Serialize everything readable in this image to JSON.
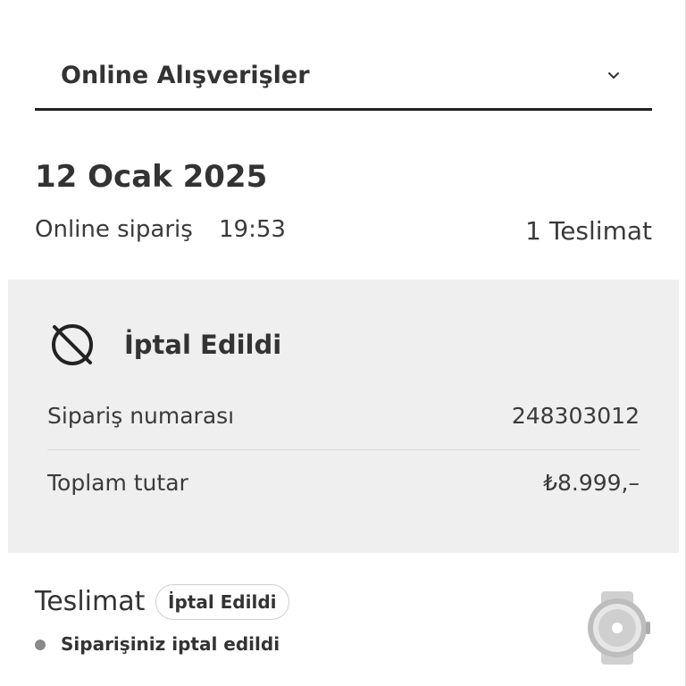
{
  "dropdown": {
    "title": "Online Alışverişler",
    "icon": "chevron-down-icon"
  },
  "order": {
    "date": "12 Ocak 2025",
    "type": "Online sipariş",
    "time": "19:53",
    "delivery_count": "1 Teslimat"
  },
  "status_card": {
    "status_icon": "cancelled-icon",
    "status": "İptal Edildi",
    "rows": [
      {
        "label": "Sipariş numarası",
        "value": "248303012"
      },
      {
        "label": "Toplam tutar",
        "value": "₺8.999,–"
      }
    ]
  },
  "delivery": {
    "heading": "Teslimat",
    "badge": "İptal Edildi",
    "message": "Siparişiniz iptal edildi",
    "product_image": "smartwatch-thumbnail"
  },
  "colors": {
    "text": "#333333",
    "card_background": "#efefef",
    "divider": "#222222",
    "bullet": "#8a8a8a"
  }
}
